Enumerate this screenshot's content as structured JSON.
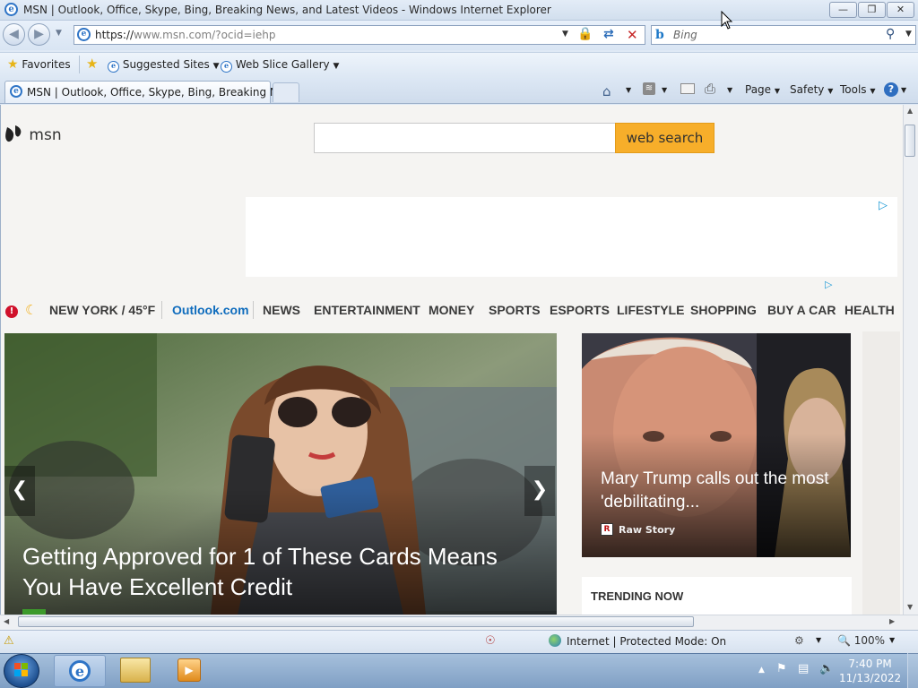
{
  "window": {
    "title": "MSN | Outlook, Office, Skype, Bing, Breaking News, and Latest Videos - Windows Internet Explorer"
  },
  "address_bar": {
    "url_prefix": "https://",
    "url_domain": "www.msn.com",
    "url_path": "/?ocid=iehp"
  },
  "search_bar": {
    "placeholder": "Bing"
  },
  "favorites_bar": {
    "favorites_label": "Favorites",
    "suggested_sites_label": "Suggested Sites",
    "web_slice_gallery_label": "Web Slice Gallery"
  },
  "tabs": [
    {
      "label": "MSN | Outlook, Office, Skype, Bing, Breaking Ne..."
    }
  ],
  "command_bar": {
    "page_label": "Page",
    "safety_label": "Safety",
    "tools_label": "Tools"
  },
  "msn": {
    "logo_text": "msn",
    "search_button_label": "web search",
    "weather": "NEW YORK / 45°F",
    "nav": [
      "Outlook.com",
      "NEWS",
      "ENTERTAINMENT",
      "MONEY",
      "SPORTS",
      "ESPORTS",
      "LIFESTYLE",
      "SHOPPING",
      "BUY A CAR",
      "HEALTH"
    ],
    "hero_headline": "Getting Approved for 1 of These Cards Means You Have Excellent Credit",
    "side_headline": "Mary Trump calls out the most 'debilitating...",
    "side_source": "Raw Story",
    "trending_label": "TRENDING NOW"
  },
  "status_bar": {
    "zone_text": "Internet | Protected Mode: On",
    "zoom": "100%"
  },
  "taskbar": {
    "time": "7:40 PM",
    "date": "11/13/2022"
  },
  "colors": {
    "search_button": "#f7ae2a",
    "outlook_link": "#0f6cbd",
    "alert_red": "#d0112b"
  }
}
